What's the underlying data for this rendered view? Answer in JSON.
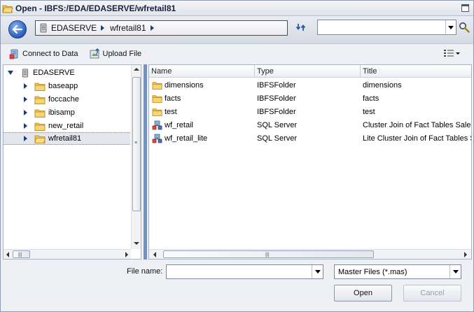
{
  "window": {
    "title": "Open - IBFS:/EDA/EDASERVE/wfretail81"
  },
  "nav": {
    "breadcrumb": [
      "EDASERVE",
      "wfretail81"
    ],
    "search_value": ""
  },
  "toolbar": {
    "connect_label": "Connect to Data",
    "upload_label": "Upload File"
  },
  "tree": {
    "root": "EDASERVE",
    "items": [
      {
        "label": "baseapp"
      },
      {
        "label": "foccache"
      },
      {
        "label": "ibisamp"
      },
      {
        "label": "new_retail"
      },
      {
        "label": "wfretail81"
      }
    ]
  },
  "list": {
    "columns": [
      "Name",
      "Type",
      "Title"
    ],
    "rows": [
      {
        "name": "dimensions",
        "type": "IBFSFolder",
        "title": "dimensions",
        "icon": "folder-icon"
      },
      {
        "name": "facts",
        "type": "IBFSFolder",
        "title": "facts",
        "icon": "folder-icon"
      },
      {
        "name": "test",
        "type": "IBFSFolder",
        "title": "test",
        "icon": "folder-icon"
      },
      {
        "name": "wf_retail",
        "type": "SQL Server",
        "title": "Cluster Join of Fact Tables Sales,",
        "icon": "sql-table-icon"
      },
      {
        "name": "wf_retail_lite",
        "type": "SQL Server",
        "title": "Lite Cluster Join of Fact Tables Sa",
        "icon": "sql-table-icon"
      }
    ]
  },
  "footer": {
    "filename_label": "File name:",
    "filename_value": "",
    "filter_value": "Master Files (*.mas)",
    "open_label": "Open",
    "cancel_label": "Cancel"
  },
  "colors": {
    "accent": "#6d93cf",
    "folder": "#f2c14e",
    "selected_row": "#e3e6ec"
  }
}
